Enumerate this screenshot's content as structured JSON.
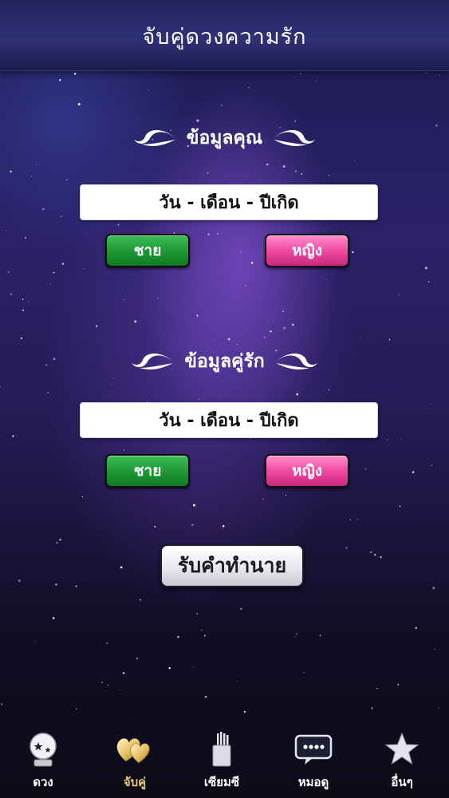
{
  "header": {
    "title": "จับคู่ดวงความรัก"
  },
  "you": {
    "section_label": "ข้อมูลคุณ",
    "birthdate_label": "วัน - เดือน - ปีเกิด",
    "male_label": "ชาย",
    "female_label": "หญิง"
  },
  "partner": {
    "section_label": "ข้อมูลคู่รัก",
    "birthdate_label": "วัน - เดือน - ปีเกิด",
    "male_label": "ชาย",
    "female_label": "หญิง"
  },
  "predict_button": "รับคำทำนาย",
  "tabs": [
    {
      "label": "ดวง",
      "icon": "crystal-ball-icon"
    },
    {
      "label": "จับคู่",
      "icon": "hearts-icon",
      "active": true
    },
    {
      "label": "เซียมซี",
      "icon": "fortune-sticks-icon"
    },
    {
      "label": "หมอดู",
      "icon": "chat-bubble-icon"
    },
    {
      "label": "อื่นๆ",
      "icon": "star-icon"
    }
  ],
  "colors": {
    "male_button": "#1f9a35",
    "female_button": "#f04aa5",
    "active_tab": "#e9c97a"
  }
}
